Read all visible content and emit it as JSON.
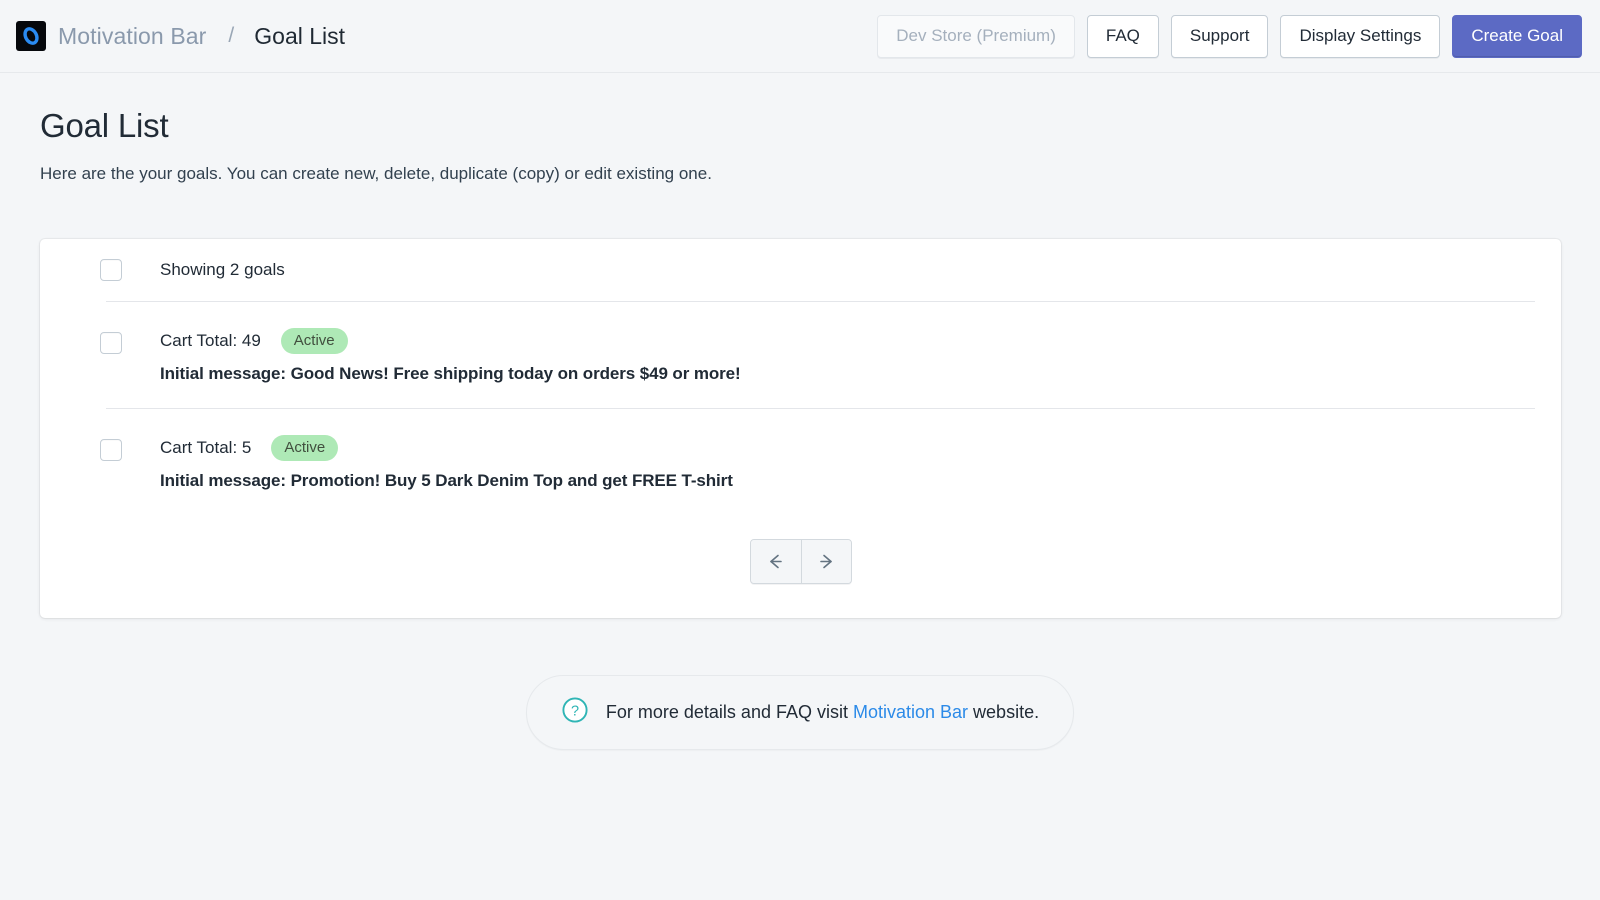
{
  "header": {
    "logo_icon": "motivation-bar-logo-icon",
    "brand_name": "Motivation Bar",
    "separator": "/",
    "current_page": "Goal List",
    "actions": [
      {
        "label": "Dev Store (Premium)",
        "name": "store-button",
        "state": "disabled"
      },
      {
        "label": "FAQ",
        "name": "faq-button",
        "state": "default"
      },
      {
        "label": "Support",
        "name": "support-button",
        "state": "default"
      },
      {
        "label": "Display Settings",
        "name": "display-settings-button",
        "state": "default"
      },
      {
        "label": "Create Goal",
        "name": "create-goal-button",
        "state": "primary"
      }
    ]
  },
  "page": {
    "title": "Goal List",
    "subtitle": "Here are the your goals. You can create new, delete, duplicate (copy) or edit existing one."
  },
  "list": {
    "summary_label": "Showing 2 goals",
    "goals": [
      {
        "title": "Cart Total: 49",
        "status": "Active",
        "message": "Initial message: Good News! Free shipping today on orders $49 or more!"
      },
      {
        "title": "Cart Total: 5",
        "status": "Active",
        "message": "Initial message: Promotion! Buy 5 Dark Denim Top and get FREE T-shirt"
      }
    ],
    "pagination": {
      "previous_icon": "arrow-left-icon",
      "next_icon": "arrow-right-icon"
    }
  },
  "footer": {
    "help_icon": "question-mark-circle-icon",
    "text_before": "For more details and FAQ visit ",
    "link_label": "Motivation Bar",
    "text_after": " website."
  },
  "colors": {
    "background": "#f4f6f8",
    "primary": "#5c6ac4",
    "badge_success": "#aee9b6",
    "link": "#2b8ae8",
    "help_icon": "#2fb5b5"
  }
}
